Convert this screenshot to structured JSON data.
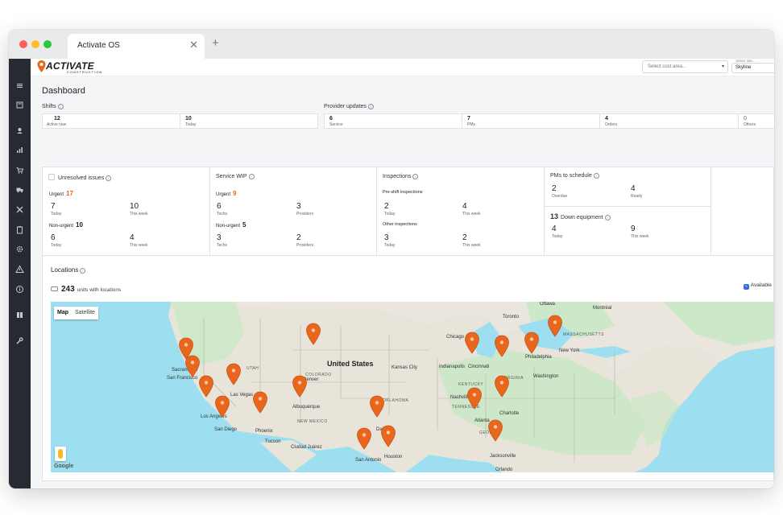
{
  "browser": {
    "tab_title": "Activate OS",
    "close_glyph": "✕",
    "new_tab_glyph": "+"
  },
  "sidebar": {
    "icons": [
      "menu-icon",
      "dashboard-icon",
      "user-icon",
      "chart-icon",
      "cart-icon",
      "truck-icon",
      "tools-icon",
      "clipboard-icon",
      "gear-icon",
      "warning-icon",
      "info-icon",
      "book-icon",
      "wrench-icon"
    ]
  },
  "header": {
    "brand": "ACTIVATE",
    "brand_sub": "CONSTRUCTION",
    "cost_area_placeholder": "Select cost area...",
    "site_label": "Select site...",
    "site_value": "Skyline"
  },
  "page": {
    "title": "Dashboard"
  },
  "shifts": {
    "label": "Shifts",
    "cells": [
      {
        "value": "12",
        "label": "Active now"
      },
      {
        "value": "10",
        "label": "Today"
      }
    ]
  },
  "provider_updates": {
    "label": "Provider updates",
    "cells": [
      {
        "value": "6",
        "label": "Service"
      },
      {
        "value": "7",
        "label": "PMs"
      },
      {
        "value": "4",
        "label": "Orders"
      },
      {
        "value": "0",
        "label": "Others"
      }
    ]
  },
  "unresolved": {
    "title": "Unresolved issues",
    "urgent_label": "Urgent",
    "urgent_count": "17",
    "urgent": [
      {
        "value": "7",
        "label": "Today"
      },
      {
        "value": "10",
        "label": "This week"
      }
    ],
    "nonurgent_label": "Non-urgent",
    "nonurgent_count": "10",
    "nonurgent": [
      {
        "value": "6",
        "label": "Today"
      },
      {
        "value": "4",
        "label": "This week"
      }
    ]
  },
  "service_wip": {
    "title": "Service WIP",
    "urgent_label": "Urgent",
    "urgent_count": "9",
    "urgent": [
      {
        "value": "6",
        "label": "Techs"
      },
      {
        "value": "3",
        "label": "Providers"
      }
    ],
    "nonurgent_label": "Non-urgent",
    "nonurgent_count": "5",
    "nonurgent": [
      {
        "value": "3",
        "label": "Techs"
      },
      {
        "value": "2",
        "label": "Providers"
      }
    ]
  },
  "inspections": {
    "title": "Inspections",
    "preshift_label": "Pre-shift inspections",
    "preshift": [
      {
        "value": "2",
        "label": "Today"
      },
      {
        "value": "4",
        "label": "This week"
      }
    ],
    "other_label": "Other inspections",
    "other": [
      {
        "value": "3",
        "label": "Today"
      },
      {
        "value": "2",
        "label": "This week"
      }
    ]
  },
  "pms": {
    "title": "PMs to schedule",
    "items": [
      {
        "value": "2",
        "label": "Overdue"
      },
      {
        "value": "4",
        "label": "Ready"
      }
    ]
  },
  "down_equipment": {
    "count": "13",
    "title": "Down equipment",
    "items": [
      {
        "value": "4",
        "label": "Today"
      },
      {
        "value": "9",
        "label": "This week"
      }
    ]
  },
  "locations": {
    "title": "Locations",
    "units_count": "243",
    "units_label": "units with locations",
    "available_label": "Available",
    "map_tab": "Map",
    "satellite_tab": "Satellite",
    "google_label": "Google",
    "colors": {
      "water": "#9ddff0",
      "land": "#eae6de",
      "green": "#c9e8c5",
      "pin": "#e8671c"
    }
  },
  "map_labels": {
    "ottawa": "Ottawa",
    "montreal": "Montréal",
    "toronto": "Toronto",
    "chicago": "Chicago",
    "new_york": "New York",
    "philadelphia": "Philadelphia",
    "washington": "Washington",
    "indianapolis": "Indianapolis",
    "cincinnati": "Cincinnati",
    "nashville": "Nashville",
    "atlanta": "Atlanta",
    "charlotte": "Charlotte",
    "jacksonville": "Jacksonville",
    "orlando": "Orlando",
    "denver": "Denver",
    "kansas_city": "Kansas City",
    "dallas": "Dallas",
    "houston": "Houston",
    "san_antonio": "San Antonio",
    "albuquerque": "Albuquerque",
    "phoenix": "Phoenix",
    "tucson": "Tucson",
    "las_vegas": "Las Vegas",
    "los_angeles": "Los Angeles",
    "san_diego": "San Diego",
    "san_francisco": "San Francisco",
    "sacramento": "Sacramento",
    "ciudad_juarez": "Ciudad Juárez",
    "united_states": "United States",
    "colorado": "COLORADO",
    "new_mexico": "NEW MEXICO",
    "tennessee": "TENNESSEE",
    "oklahoma": "OKLAHOMA",
    "virginia": "VIRGINIA",
    "massachusetts": "MASSACHUSETTS",
    "georgia": "GEORGIA",
    "utah": "UTAH",
    "kentucky": "KENTUCKY"
  }
}
